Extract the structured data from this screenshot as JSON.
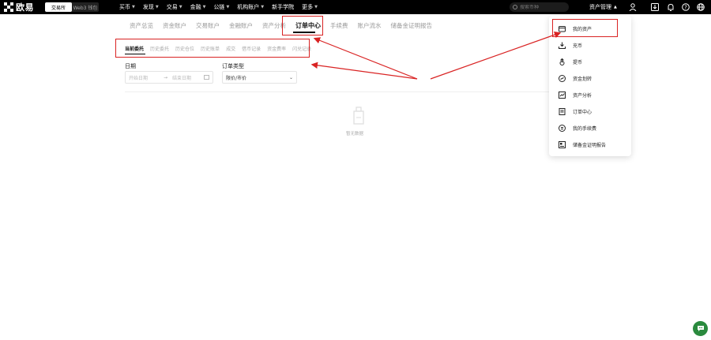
{
  "brand": {
    "logo_text": "欧易"
  },
  "mode_toggle": {
    "simple": "交易所",
    "web3": "Web3 钱包"
  },
  "nav": [
    {
      "label": "买币",
      "caret": true
    },
    {
      "label": "发现",
      "caret": true
    },
    {
      "label": "交易",
      "caret": true
    },
    {
      "label": "金融",
      "caret": true
    },
    {
      "label": "公链",
      "caret": true
    },
    {
      "label": "机构账户",
      "caret": true
    },
    {
      "label": "新手学院",
      "caret": false
    },
    {
      "label": "更多",
      "caret": true
    }
  ],
  "search": {
    "placeholder": "搜索币种"
  },
  "asset_menu": {
    "label": "资产管理"
  },
  "tabs": [
    "资产总览",
    "资金账户",
    "交易账户",
    "金融账户",
    "资产分析",
    "订单中心",
    "手续费",
    "账户流水",
    "储备金证明报告"
  ],
  "active_tab": "订单中心",
  "subtabs": [
    "当前委托",
    "历史委托",
    "历史仓位",
    "历史账单",
    "成交",
    "借币记录",
    "资金费率",
    "闪兑记录"
  ],
  "active_subtab": "当前委托",
  "filters": {
    "date_label": "日期",
    "start_placeholder": "开始日期",
    "end_placeholder": "结束日期",
    "date_separator": "→",
    "type_label": "订单类型",
    "type_value": "限价/市价"
  },
  "empty_text": "暂无数据",
  "dropdown": {
    "items": [
      {
        "label": "我的资产",
        "icon": "wallet-icon"
      },
      {
        "label": "充币",
        "icon": "deposit-icon"
      },
      {
        "label": "提币",
        "icon": "withdraw-icon"
      },
      {
        "label": "资金划转",
        "icon": "transfer-icon"
      },
      {
        "label": "资产分析",
        "icon": "analysis-icon"
      },
      {
        "label": "订单中心",
        "icon": "order-icon"
      },
      {
        "label": "我的手续费",
        "icon": "fee-icon"
      },
      {
        "label": "储备金证明报告",
        "icon": "report-icon"
      }
    ]
  },
  "colors": {
    "highlight": "#d92323",
    "topbar": "#000000",
    "chat": "#2a8a3e"
  }
}
